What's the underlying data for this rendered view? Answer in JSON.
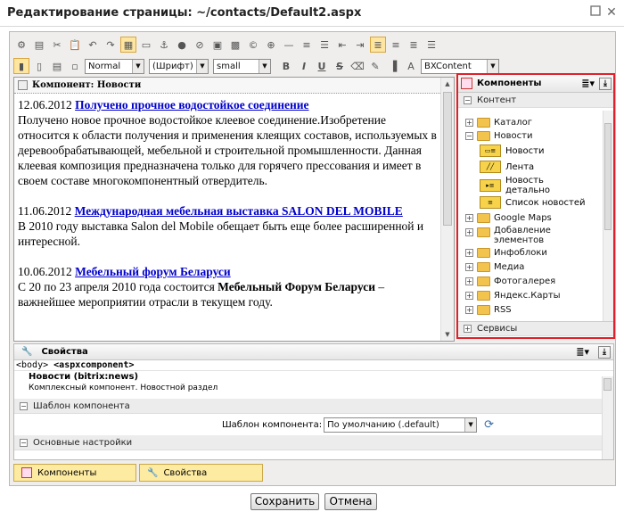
{
  "window": {
    "title": "Редактирование страницы: ~/contacts/Default2.aspx"
  },
  "toolbar": {
    "style_select": "Normal",
    "font_select": "(Шрифт)",
    "size_select": "small",
    "css_select": "BXContent"
  },
  "editor": {
    "component_header": "Компонент: Новости",
    "news": [
      {
        "date": "12.06.2012",
        "title": "Получено прочное водостойкое соединение",
        "text": "Получено новое прочное водостойкое клеевое соединение.Изобретение относится к области получения и применения клеящих составов, используемых в деревообрабатывающей, мебельной и строительной промышленности. Данная клеевая композиция предназначена только для горячего прессования и имеет в своем составе многокомпонентный отвердитель."
      },
      {
        "date": "11.06.2012",
        "title": "Международная мебельная выставка SALON DEL MOBILE",
        "text": "В 2010 году выставка Salon del Mobile обещает быть еще более расширенной и интересной."
      },
      {
        "date": "10.06.2012",
        "title": "Мебельный форум Беларуси",
        "text_before": "С 20 по 23 апреля 2010 года состоится ",
        "text_bold": "Мебельный Форум Беларуси",
        "text_after": " – важнейшее мероприятии отрасли в текущем году."
      }
    ]
  },
  "components_panel": {
    "title": "Компоненты",
    "section_content": "Контент",
    "section_services": "Сервисы",
    "tree": {
      "catalog": "Каталог",
      "news": "Новости",
      "news_children": [
        {
          "label": "Новости"
        },
        {
          "label": "Лента"
        },
        {
          "label1": "Новость",
          "label2": "детально"
        },
        {
          "label": "Список новостей"
        }
      ],
      "others": [
        "Google Maps",
        "Добавление",
        "Инфоблоки",
        "Медиа",
        "Фотогалерея",
        "Яндекс.Карты",
        "RSS"
      ],
      "add_elements_line2": "элементов"
    }
  },
  "properties": {
    "title": "Свойства",
    "path_body": "<body>",
    "path_component": "<aspxcomponent>",
    "component_name": "Новости (bitrix:news)",
    "component_desc": "Комплексный компонент. Новостной раздел",
    "section_template": "Шаблон компонента",
    "template_label": "Шаблон компонента:",
    "template_value": "По умолчанию (.default)",
    "section_main": "Основные настройки"
  },
  "tabs": {
    "components": "Компоненты",
    "properties": "Свойства"
  },
  "buttons": {
    "save": "Сохранить",
    "cancel": "Отмена"
  },
  "colors": {
    "highlight_border": "#e0202a",
    "link": "#0000cc",
    "tab_bg": "#fdeba2"
  }
}
